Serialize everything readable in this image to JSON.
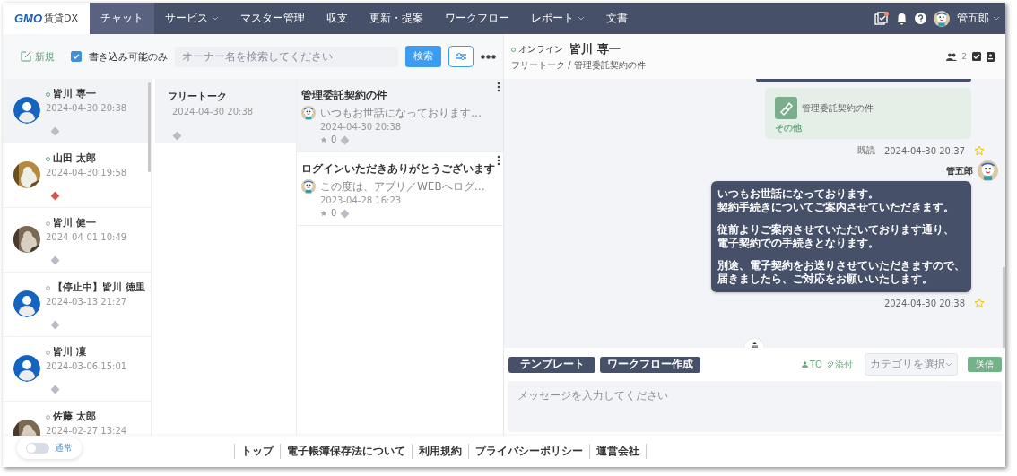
{
  "nav": {
    "logo": {
      "mark": "GMO",
      "text": "賃貸DX"
    },
    "items": [
      {
        "label": "チャット",
        "selected": true,
        "dropdown": false
      },
      {
        "label": "サービス",
        "selected": false,
        "dropdown": true
      },
      {
        "label": "マスター管理",
        "selected": false,
        "dropdown": false
      },
      {
        "label": "収支",
        "selected": false,
        "dropdown": false
      },
      {
        "label": "更新・提案",
        "selected": false,
        "dropdown": false
      },
      {
        "label": "ワークフロー",
        "selected": false,
        "dropdown": false
      },
      {
        "label": "レポート",
        "selected": false,
        "dropdown": true
      },
      {
        "label": "文書",
        "selected": false,
        "dropdown": false
      }
    ],
    "user": "管五郎",
    "task_notice": true
  },
  "toolbar": {
    "new_label": "新規",
    "writable_only": {
      "label": "書き込み可能のみ",
      "checked": true
    },
    "search": {
      "placeholder": "オーナー名を検索してください"
    },
    "search_button": "検索"
  },
  "contacts": [
    {
      "name": "皆川 専一",
      "time": "2024-04-30 20:38",
      "online": true,
      "kind": "default",
      "color": "#b9bcc4",
      "selected": true
    },
    {
      "name": "山田 太郎",
      "time": "2024-04-30 19:58",
      "online": true,
      "color": "#d9534f",
      "selected": false
    },
    {
      "name": "皆川 健一",
      "time": "2024-04-01 10:49",
      "online": false,
      "color": "#b9bcc4",
      "selected": false
    },
    {
      "name": "【停止中】皆川 徳里",
      "time": "2024-03-13 21:27",
      "online": false,
      "kind": "default",
      "color": "#b9bcc4",
      "selected": false
    },
    {
      "name": "皆川 凜",
      "time": "2024-03-06 15:01",
      "online": false,
      "kind": "default",
      "color": "#b9bcc4",
      "selected": false
    },
    {
      "name": "佐藤 太郎",
      "time": "2024-02-27 13:24",
      "online": false,
      "selected": false
    }
  ],
  "threads": [
    {
      "title": "フリートーク",
      "time": "2024-04-30 20:38",
      "selected": true
    }
  ],
  "topics": [
    {
      "title": "管理委託契約の件",
      "preview": "いつもお世話になっております…",
      "time": "2024-04-30 20:38",
      "stars": "0",
      "selected": true
    },
    {
      "title": "ログインいただきありがとうございます",
      "preview": "この度は、アプリ／WEBへログ…",
      "time": "2023-04-28 16:23",
      "stars": "0",
      "selected": false
    }
  ],
  "chat": {
    "status": "オンライン",
    "online": true,
    "name": "皆川 専一",
    "path": "フリートーク / 管理委託契約の件",
    "members": "2",
    "messages": [
      {
        "kind": "card",
        "title": "管理委託契約の件",
        "category": "その他",
        "read": "既読",
        "time": "2024-04-30 20:37",
        "starred": false
      },
      {
        "kind": "text",
        "sender": "管五郎",
        "paragraphs": [
          [
            "いつもお世話になっております。",
            "契約手続きについてご案内させていただきます。"
          ],
          [
            "従前よりご案内させていただいております通り、",
            "電子契約での手続きとなります。"
          ],
          [
            "別途、電子契約をお送りさせていただきますので、",
            "届きましたら、ご対応をお願いいたします。"
          ]
        ],
        "time": "2024-04-30 20:38",
        "starred": false
      }
    ]
  },
  "composer": {
    "buttons": [
      "テンプレート",
      "ワークフロー作成"
    ],
    "to": "TO",
    "attach": "添付",
    "category": {
      "placeholder": "カテゴリを選択"
    },
    "send": "送信",
    "message": {
      "placeholder": "メッセージを入力してください"
    }
  },
  "footer": {
    "mode": {
      "label": "通常",
      "on": false
    },
    "links": [
      "トップ",
      "電子帳簿保存法について",
      "利用規約",
      "プライバシーポリシー",
      "運営会社"
    ]
  }
}
